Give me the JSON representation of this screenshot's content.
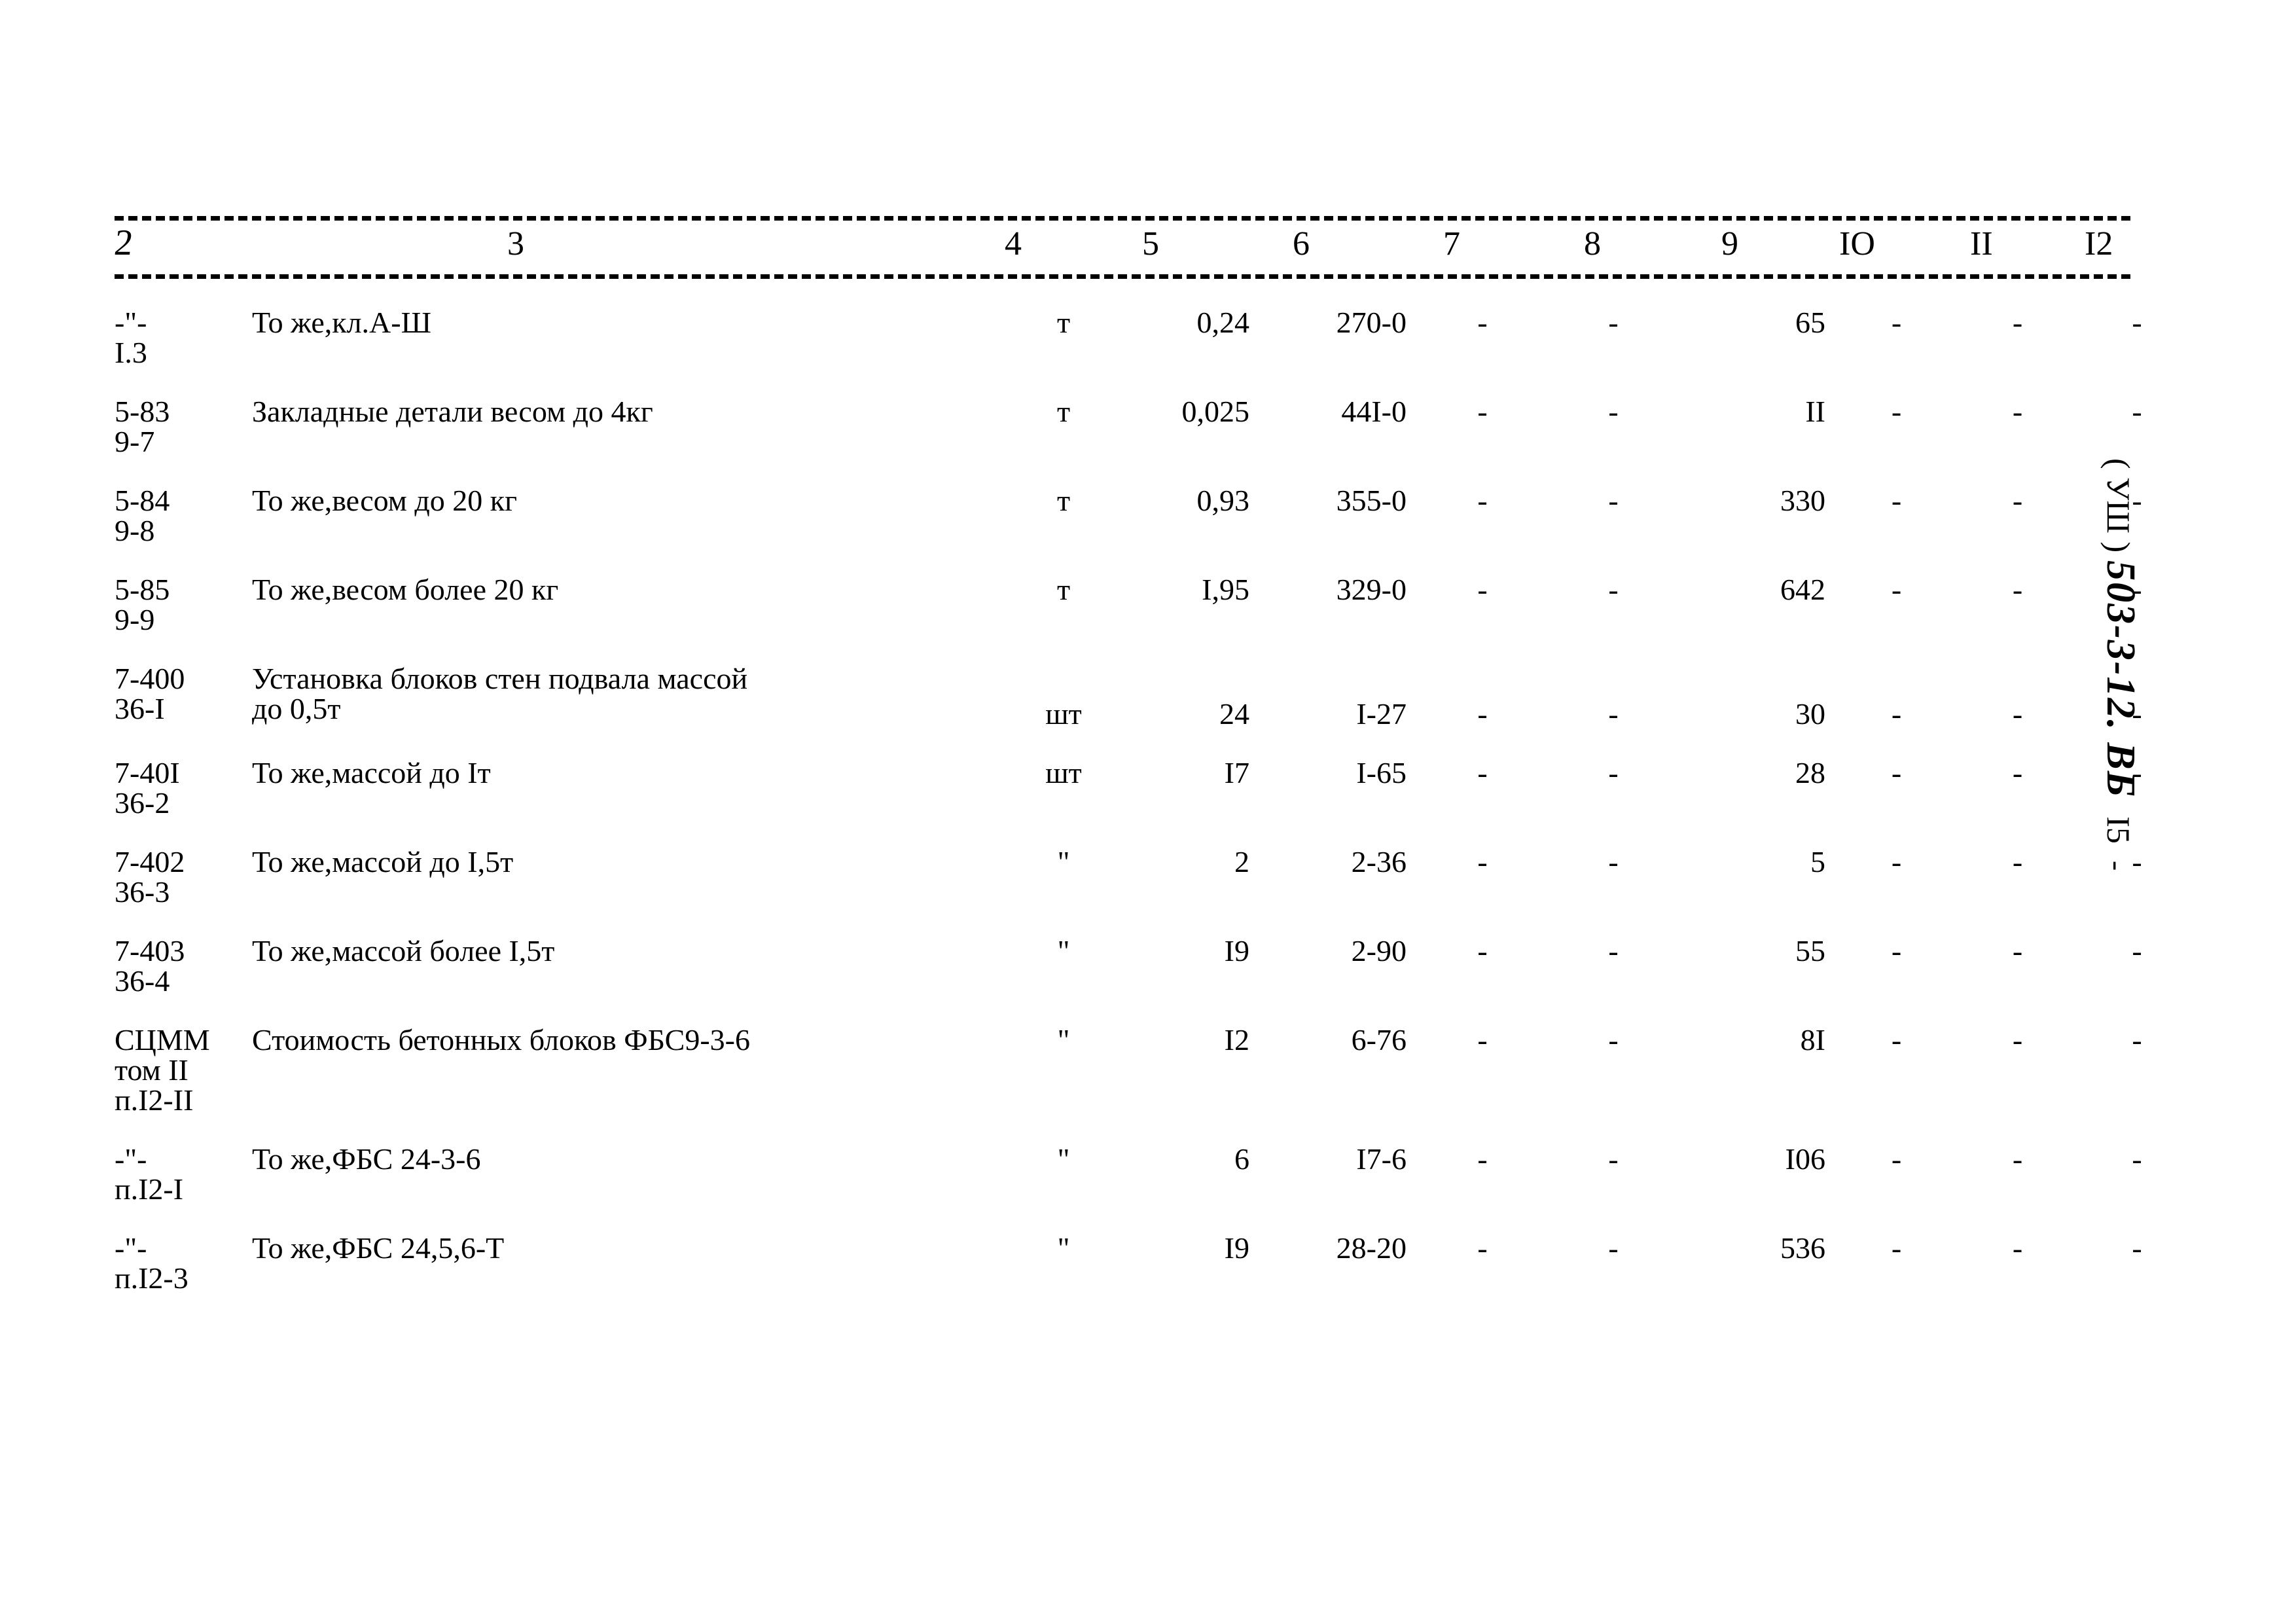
{
  "document": {
    "kind": "scanned-estimate-table",
    "margin_stamp": {
      "volume": "( УШ )",
      "project_code": "503-3-12. ВБ",
      "page_number": "I5",
      "tail_mark": "-"
    }
  },
  "table": {
    "column_headers": [
      "2",
      "3",
      "4",
      "5",
      "6",
      "7",
      "8",
      "9",
      "IO",
      "II",
      "I2"
    ],
    "rows": [
      {
        "code": "-\"-\nI.3",
        "code_line1": "-\"-",
        "code_line2": "I.3",
        "description": "То же,кл.А-Ш",
        "description_line2": "",
        "unit": "т",
        "qty": "0,24",
        "price": "270-0",
        "c7": "-",
        "c8": "-",
        "total": "65",
        "c10": "-",
        "c11": "-",
        "c12": "-"
      },
      {
        "code_line1": "5-83",
        "code_line2": "9-7",
        "description": "Закладные детали весом до 4кг",
        "description_line2": "",
        "unit": "т",
        "qty": "0,025",
        "price": "44I-0",
        "c7": "-",
        "c8": "-",
        "total": "II",
        "c10": "-",
        "c11": "-",
        "c12": "-"
      },
      {
        "code_line1": "5-84",
        "code_line2": "9-8",
        "description": "То же,весом до 20 кг",
        "description_line2": "",
        "unit": "т",
        "qty": "0,93",
        "price": "355-0",
        "c7": "-",
        "c8": "-",
        "total": "330",
        "c10": "-",
        "c11": "-",
        "c12": "-"
      },
      {
        "code_line1": "5-85",
        "code_line2": "9-9",
        "description": "То же,весом более 20 кг",
        "description_line2": "",
        "unit": "т",
        "qty": "I,95",
        "price": "329-0",
        "c7": "-",
        "c8": "-",
        "total": "642",
        "c10": "-",
        "c11": "-",
        "c12": "-"
      },
      {
        "code_line1": "7-400",
        "code_line2": "36-I",
        "description": "Установка блоков стен подвала массой",
        "description_line2": "до 0,5т",
        "unit": "шт",
        "qty": "24",
        "price": "I-27",
        "c7": "-",
        "c8": "-",
        "total": "30",
        "c10": "-",
        "c11": "-",
        "c12": "-"
      },
      {
        "code_line1": "7-40I",
        "code_line2": "36-2",
        "description": "То же,массой до Iт",
        "description_line2": "",
        "unit": "шт",
        "qty": "I7",
        "price": "I-65",
        "c7": "-",
        "c8": "-",
        "total": "28",
        "c10": "-",
        "c11": "-",
        "c12": "-"
      },
      {
        "code_line1": "7-402",
        "code_line2": "36-3",
        "description": "То же,массой до I,5т",
        "description_line2": "",
        "unit": "\"",
        "qty": "2",
        "price": "2-36",
        "c7": "-",
        "c8": "-",
        "total": "5",
        "c10": "-",
        "c11": "-",
        "c12": "-"
      },
      {
        "code_line1": "7-403",
        "code_line2": "36-4",
        "description": "То же,массой более I,5т",
        "description_line2": "",
        "unit": "\"",
        "qty": "I9",
        "price": "2-90",
        "c7": "-",
        "c8": "-",
        "total": "55",
        "c10": "-",
        "c11": "-",
        "c12": "-"
      },
      {
        "code_line1": "СЦММ",
        "code_line2": "том II",
        "code_line3": "п.I2-II",
        "description": "Стоимость бетонных блоков ФБС9-3-6",
        "description_line2": "",
        "unit": "\"",
        "qty": "I2",
        "price": "6-76",
        "c7": "-",
        "c8": "-",
        "total": "8I",
        "c10": "-",
        "c11": "-",
        "c12": "-"
      },
      {
        "code_line1": "-\"-",
        "code_line2": "п.I2-I",
        "description": "То же,ФБС 24-3-6",
        "description_line2": "",
        "unit": "\"",
        "qty": "6",
        "price": "I7-6",
        "c7": "-",
        "c8": "-",
        "total": "I06",
        "c10": "-",
        "c11": "-",
        "c12": "-"
      },
      {
        "code_line1": "-\"-",
        "code_line2": "п.I2-3",
        "description": "То же,ФБС 24,5,6-Т",
        "description_line2": "",
        "unit": "\"",
        "qty": "I9",
        "price": "28-20",
        "c7": "-",
        "c8": "-",
        "total": "536",
        "c10": "-",
        "c11": "-",
        "c12": "-"
      }
    ]
  }
}
